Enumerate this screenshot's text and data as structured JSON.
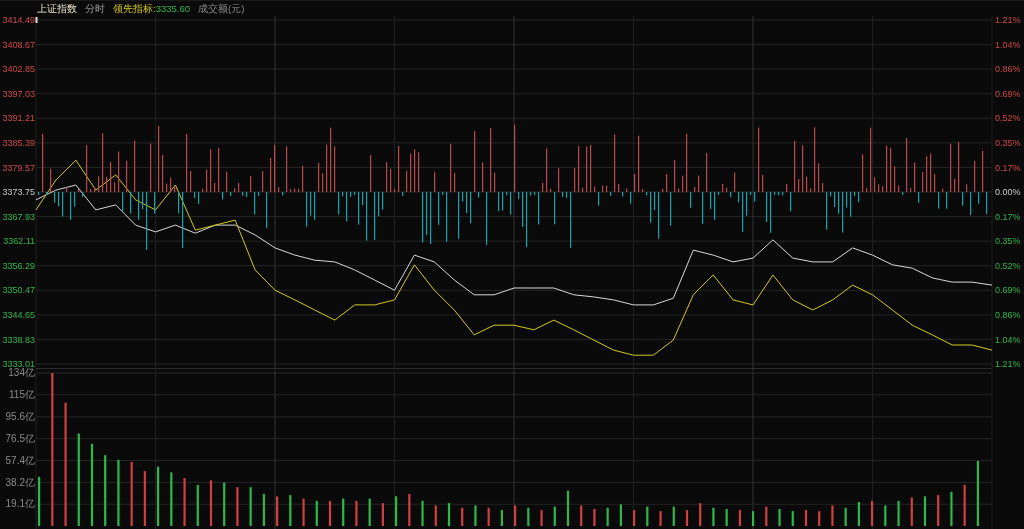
{
  "header": {
    "title": "上证指数",
    "mode": "分时",
    "indicator": {
      "label": "领先指标:",
      "value": "3335.60"
    },
    "volume_label": "成交额(元)"
  },
  "price_chart": {
    "right_labels": [
      "1.21%",
      "1.04%",
      "0.86%",
      "0.69%",
      "0.52%",
      "0.35%",
      "0.17%",
      "0.00%",
      "0.17%",
      "0.35%",
      "0.52%",
      "0.69%",
      "0.86%",
      "1.04%",
      "1.21%"
    ],
    "chart_data": {
      "type": "line",
      "grid": true,
      "ylim": [
        3333.01,
        3414.49
      ],
      "yticks": [
        {
          "value": 3414.49,
          "label": "3414.49"
        },
        {
          "value": 3408.67,
          "label": "3408.67"
        },
        {
          "value": 3402.85,
          "label": "3402.85"
        },
        {
          "value": 3397.03,
          "label": "3397.03"
        },
        {
          "value": 3391.21,
          "label": "3391.21"
        },
        {
          "value": 3385.39,
          "label": "3385.39"
        },
        {
          "value": 3379.57,
          "label": "3379.57"
        },
        {
          "value": 3373.75,
          "label": "3373.75"
        },
        {
          "value": 3367.93,
          "label": "3367.93"
        },
        {
          "value": 3362.11,
          "label": "3362.11"
        },
        {
          "value": 3356.29,
          "label": "3356.29"
        },
        {
          "value": 3350.47,
          "label": "3350.47"
        },
        {
          "value": 3344.65,
          "label": "3344.65"
        },
        {
          "value": 3338.83,
          "label": "3338.83"
        },
        {
          "value": 3333.01,
          "label": "3333.01"
        }
      ],
      "series": [
        {
          "color": "#d8d8d8",
          "values": [
            3371.9,
            3374.2,
            3375.4,
            3369.5,
            3370.7,
            3365.9,
            3364.3,
            3365.9,
            3364.0,
            3365.9,
            3365.9,
            3363.6,
            3360.5,
            3358.8,
            3357.6,
            3357.2,
            3355.3,
            3352.9,
            3350.5,
            3358.8,
            3357.2,
            3352.9,
            3349.4,
            3349.4,
            3351.0,
            3351.0,
            3351.0,
            3349.4,
            3348.9,
            3348.2,
            3347.0,
            3347.0,
            3348.6,
            3360.0,
            3358.8,
            3357.2,
            3358.1,
            3362.4,
            3358.1,
            3357.2,
            3357.2,
            3360.5,
            3358.8,
            3356.5,
            3355.7,
            3353.4,
            3352.4,
            3352.4,
            3351.7
          ]
        },
        {
          "color": "#d4c81e",
          "values": [
            3369.5,
            3376.6,
            3381.3,
            3374.2,
            3377.8,
            3371.9,
            3369.5,
            3375.4,
            3364.7,
            3365.9,
            3367.1,
            3355.3,
            3350.5,
            3348.2,
            3345.8,
            3343.4,
            3347.0,
            3347.0,
            3348.2,
            3356.5,
            3350.5,
            3345.8,
            3339.9,
            3342.2,
            3342.2,
            3341.1,
            3343.4,
            3341.1,
            3338.7,
            3336.3,
            3335.1,
            3335.1,
            3338.7,
            3349.4,
            3354.1,
            3348.2,
            3347.0,
            3354.1,
            3348.2,
            3345.8,
            3348.2,
            3351.7,
            3349.4,
            3345.8,
            3342.2,
            3339.9,
            3337.5,
            3337.5,
            3336.3
          ]
        }
      ]
    }
  },
  "volume_chart": {
    "chart_data": {
      "type": "bar",
      "stacked": true,
      "grid": true,
      "ylim": [
        0,
        134
      ],
      "yticks": [
        {
          "value": 19.1,
          "label": "19.1亿"
        },
        {
          "value": 38.2,
          "label": "38.2亿"
        },
        {
          "value": 57.4,
          "label": "57.4亿"
        },
        {
          "value": 76.5,
          "label": "76.5亿"
        },
        {
          "value": 95.6,
          "label": "95.6亿"
        },
        {
          "value": 115,
          "label": "115亿"
        },
        {
          "value": 134,
          "label": "134亿"
        }
      ],
      "series": [
        {
          "color": "#d04040",
          "values": [
            null,
            134,
            108,
            null,
            null,
            null,
            null,
            56,
            48,
            null,
            null,
            42,
            null,
            40,
            null,
            34,
            null,
            null,
            26,
            null,
            24,
            null,
            22,
            null,
            22,
            null,
            20,
            null,
            28,
            null,
            18,
            null,
            16,
            null,
            16,
            null,
            18,
            null,
            14,
            null,
            null,
            18,
            15,
            null,
            null,
            14,
            null,
            13,
            null,
            14,
            20,
            null,
            null,
            14,
            null,
            17,
            null,
            null,
            14,
            13,
            18,
            null,
            null,
            22,
            null,
            null,
            25,
            null,
            27,
            null,
            36,
            null
          ]
        },
        {
          "color": "#2fb84a",
          "values": [
            43,
            null,
            null,
            81,
            72,
            62,
            58,
            null,
            null,
            52,
            47,
            null,
            36,
            null,
            38,
            null,
            34,
            28,
            null,
            27,
            null,
            22,
            null,
            24,
            null,
            24,
            null,
            26,
            null,
            22,
            null,
            20,
            null,
            18,
            null,
            14,
            null,
            16,
            null,
            17,
            31,
            null,
            null,
            16,
            19,
            null,
            17,
            null,
            17,
            null,
            null,
            16,
            15,
            null,
            13,
            null,
            15,
            13,
            null,
            null,
            null,
            16,
            21,
            null,
            18,
            22,
            null,
            26,
            null,
            30,
            null,
            57
          ]
        }
      ]
    }
  }
}
